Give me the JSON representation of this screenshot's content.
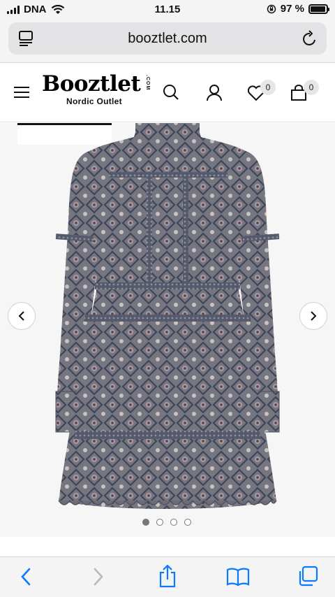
{
  "status_bar": {
    "carrier": "DNA",
    "time": "11.15",
    "battery_percent": "97 %",
    "battery_level": 0.97
  },
  "browser": {
    "url": "booztlet.com",
    "page_icon": "reader-icon",
    "reload_icon": "reload-icon"
  },
  "header": {
    "logo_text": "Booztlet",
    "logo_tld": ".COM",
    "logo_subtitle": "Nordic Outlet",
    "wishlist_count": "0",
    "cart_count": "0"
  },
  "gallery": {
    "image_alt": "product-image-dress",
    "total_images": 4,
    "active_index": 0
  },
  "toolbar": {
    "items": [
      "back-icon",
      "forward-icon",
      "share-icon",
      "bookmarks-icon",
      "tabs-icon"
    ]
  },
  "colors": {
    "accent_blue": "#0a7aff",
    "dress_base": "#6e6e78",
    "dress_pattern": "#3e4458"
  }
}
